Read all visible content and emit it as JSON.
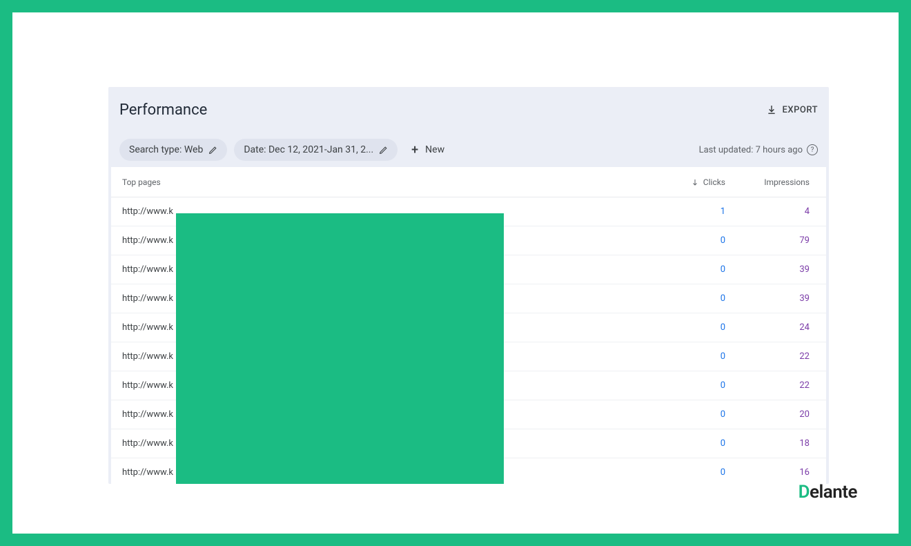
{
  "header": {
    "title": "Performance",
    "export_label": "EXPORT"
  },
  "filters": {
    "search_type": "Search type: Web",
    "date_range": "Date: Dec 12, 2021-Jan 31, 2...",
    "new_label": "New",
    "last_updated": "Last updated: 7 hours ago"
  },
  "table": {
    "headers": {
      "pages": "Top pages",
      "clicks": "Clicks",
      "impressions": "Impressions"
    },
    "rows": [
      {
        "page": "http://www.k",
        "clicks": "1",
        "impressions": "4"
      },
      {
        "page": "http://www.k",
        "clicks": "0",
        "impressions": "79"
      },
      {
        "page": "http://www.k",
        "clicks": "0",
        "impressions": "39"
      },
      {
        "page": "http://www.k",
        "clicks": "0",
        "impressions": "39"
      },
      {
        "page": "http://www.k",
        "clicks": "0",
        "impressions": "24"
      },
      {
        "page": "http://www.k",
        "clicks": "0",
        "impressions": "22"
      },
      {
        "page": "http://www.k",
        "clicks": "0",
        "impressions": "22"
      },
      {
        "page": "http://www.k",
        "clicks": "0",
        "impressions": "20"
      },
      {
        "page": "http://www.k",
        "clicks": "0",
        "impressions": "18"
      },
      {
        "page": "http://www.k",
        "clicks": "0",
        "impressions": "16"
      }
    ]
  },
  "brand": {
    "name": "elante",
    "first": "D"
  }
}
